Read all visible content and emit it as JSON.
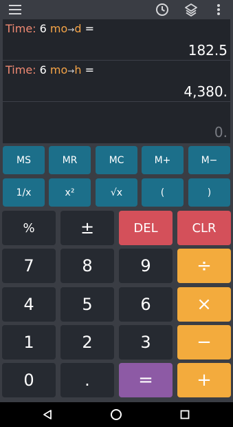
{
  "toolbar": {
    "menu_icon": "menu-icon",
    "history_icon": "history-icon",
    "layers_icon": "layers-icon",
    "more_icon": "more-vert-icon"
  },
  "display": {
    "rows": [
      {
        "label": "Time:",
        "amount": "6",
        "from": "mo",
        "arrow": "→",
        "to": "d",
        "eq": "=",
        "result": "182.5"
      },
      {
        "label": "Time:",
        "amount": "6",
        "from": "mo",
        "arrow": "→",
        "to": "h",
        "eq": "=",
        "result": "4,380."
      }
    ],
    "current": "0."
  },
  "memory": [
    "MS",
    "MR",
    "MC",
    "M+",
    "M−"
  ],
  "functions": [
    "1/x",
    "x²",
    "√x",
    "(",
    ")"
  ],
  "keys": {
    "percent": "%",
    "plusminus": "±",
    "del": "DEL",
    "clr": "CLR",
    "seven": "7",
    "eight": "8",
    "nine": "9",
    "divide": "÷",
    "four": "4",
    "five": "5",
    "six": "6",
    "multiply": "×",
    "one": "1",
    "two": "2",
    "three": "3",
    "minus": "−",
    "zero": "0",
    "dot": ".",
    "equals": "=",
    "plus": "+"
  },
  "colors": {
    "memory": "#1c6f8a",
    "number": "#262a31",
    "clear": "#d4505a",
    "operator": "#f3ab3d",
    "equals": "#8d5aa5",
    "label": "#f08a73",
    "unit": "#f5a447"
  },
  "navbar": {
    "back": "back-icon",
    "home": "home-icon",
    "recents": "recents-icon"
  }
}
